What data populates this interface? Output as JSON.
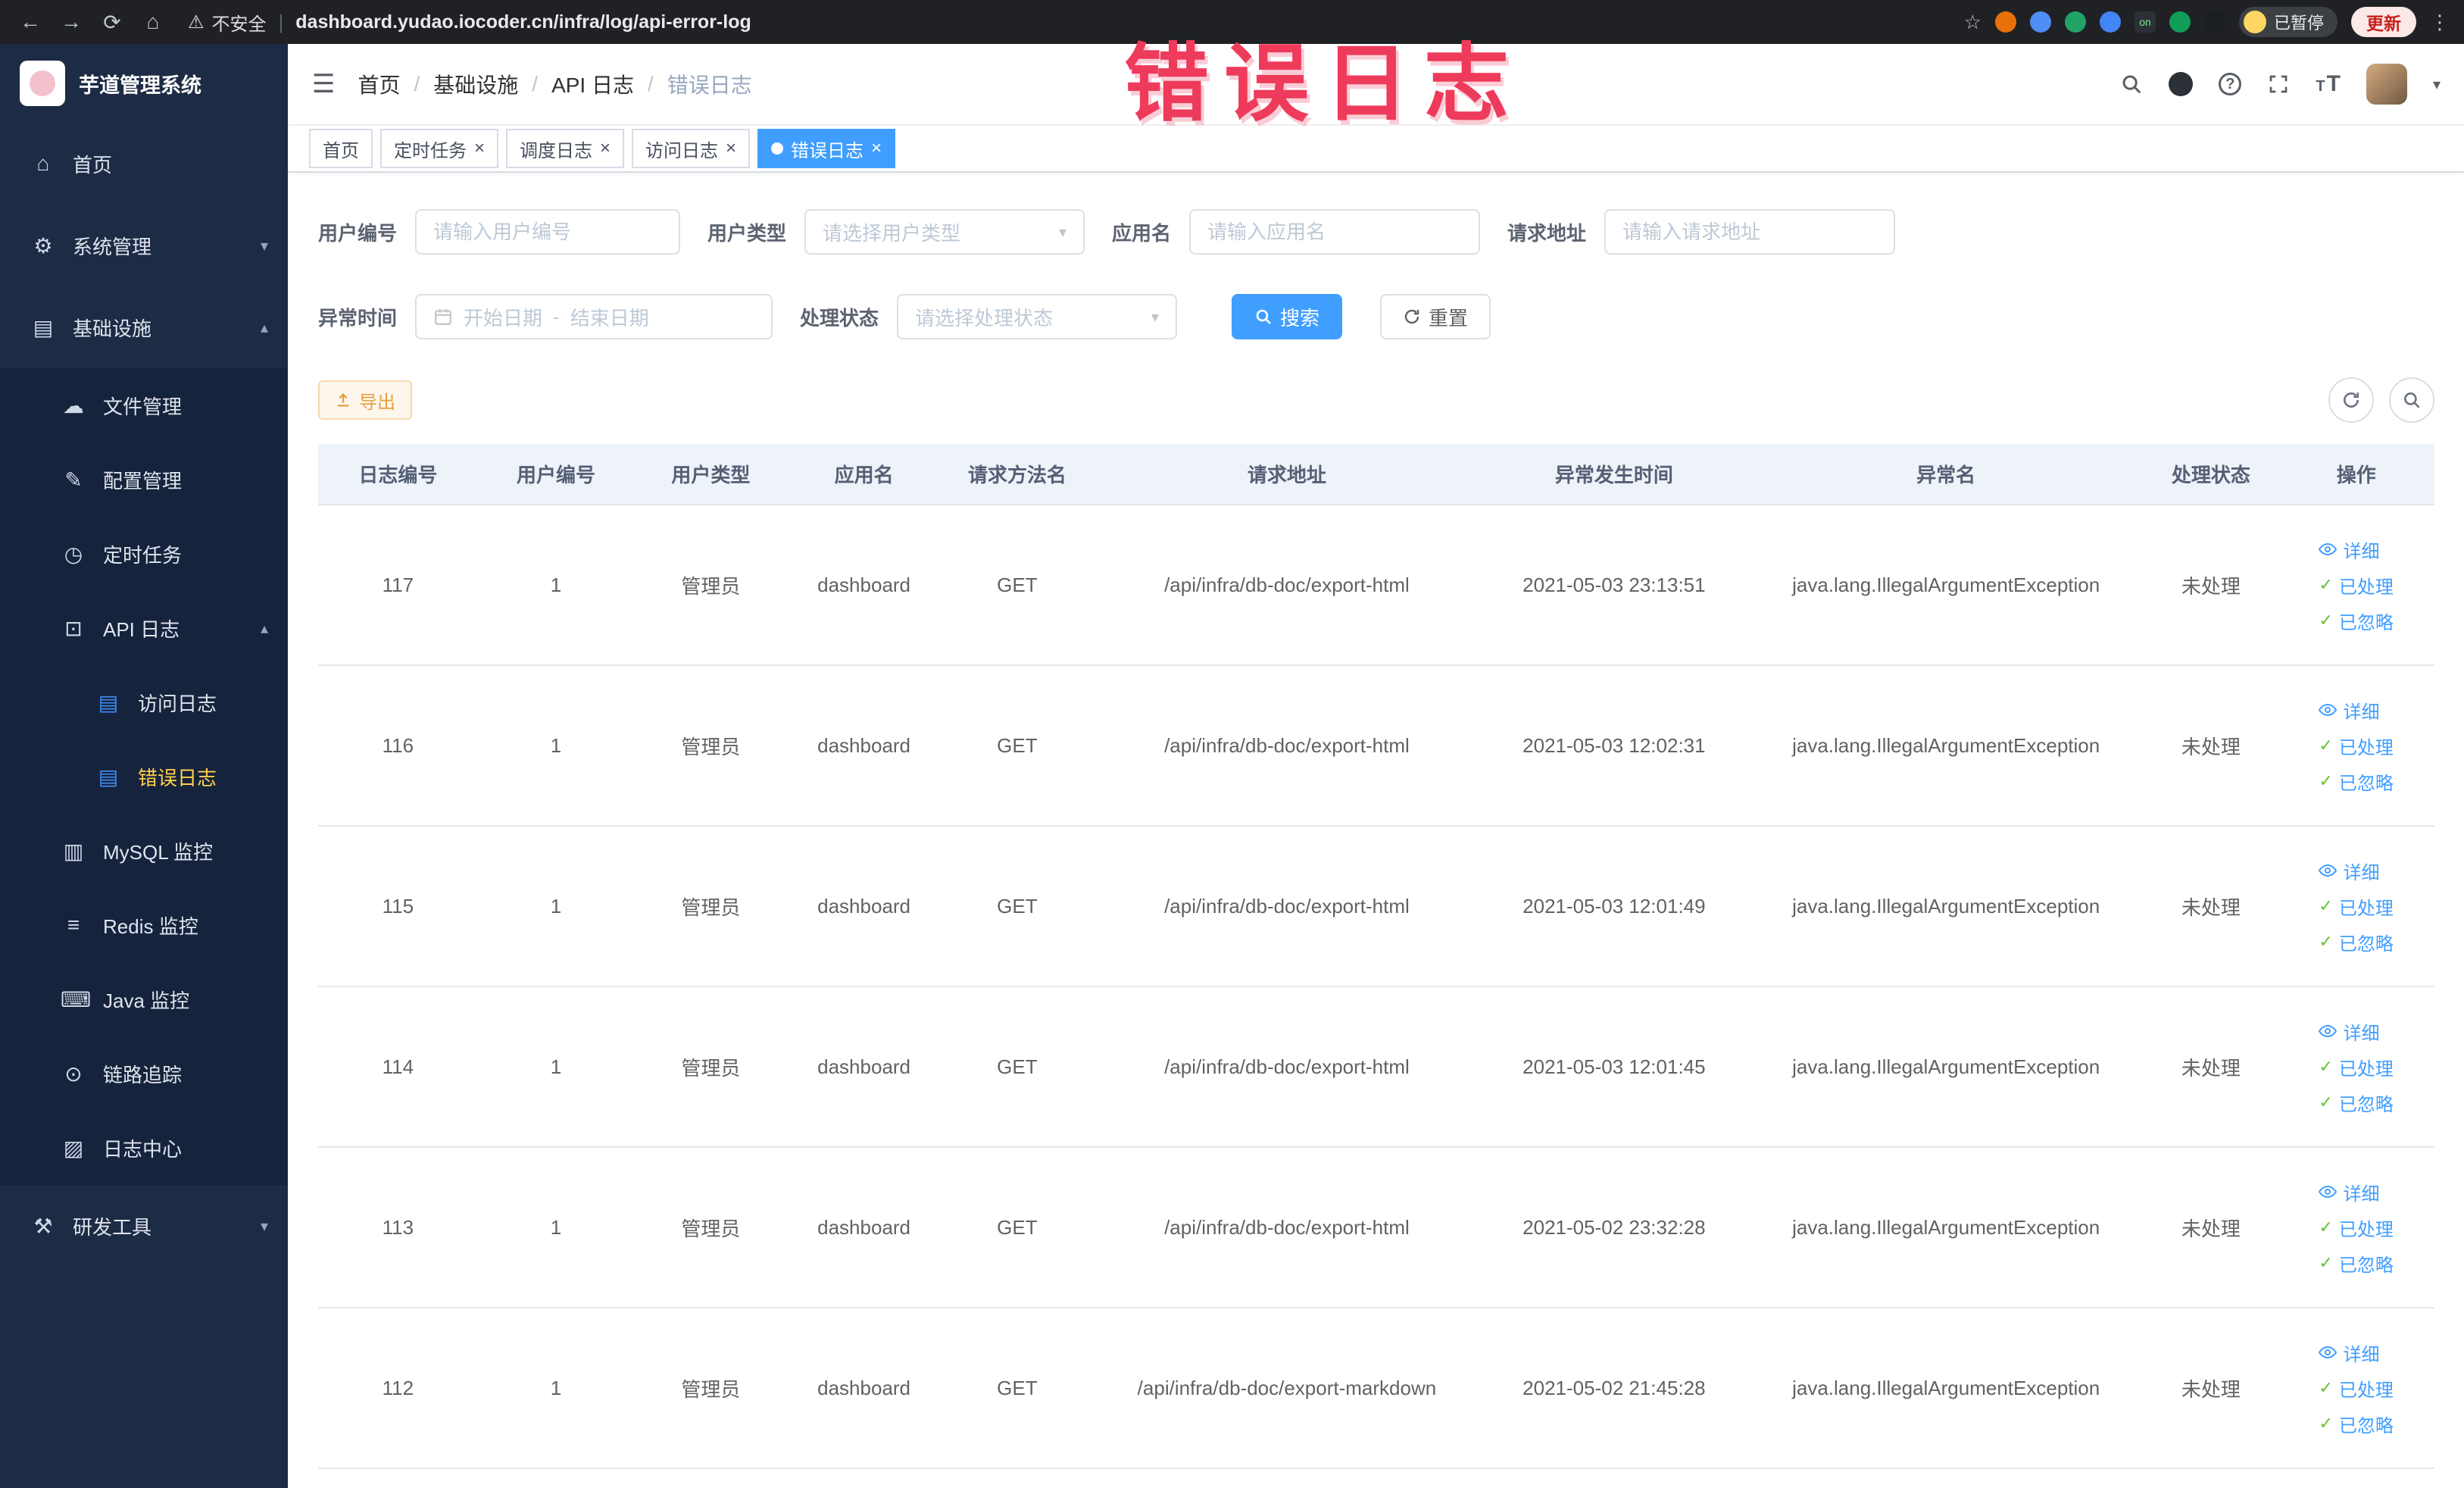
{
  "colors": {
    "accent_blue": "#409eff",
    "menu_active_yellow": "#ffd04b",
    "warning_orange": "#e6a23c",
    "success_green": "#67c23a",
    "watermark_red": "#ee3b5b",
    "sidebar_bg": "#1d2b45"
  },
  "watermark": "错误日志",
  "icons": {
    "back": "←",
    "forward": "→",
    "reload": "⟳",
    "home": "⌂",
    "warning": "⚠",
    "star": "☆",
    "more": "⋮",
    "on_badge": "on",
    "hamburger": "☰",
    "caret_down": "▾",
    "arrow_up": "▴",
    "arrow_down": "▾",
    "close": "×",
    "check": "✓",
    "question": "?",
    "menu_home": "⌂",
    "menu_system": "⚙",
    "menu_infra": "▤",
    "menu_file": "☁",
    "menu_config": "✎",
    "menu_job": "◷",
    "menu_api_log": "⊡",
    "menu_doc": "▤",
    "menu_mysql": "▥",
    "menu_redis": "≡",
    "menu_java": "⌨",
    "menu_trace": "⊙",
    "menu_log_center": "▨",
    "menu_tools": "⚒"
  },
  "browser": {
    "security_label": "不安全",
    "url": "dashboard.yudao.iocoder.cn/infra/log/api-error-log",
    "profile_badge": "已暂停",
    "update_label": "更新"
  },
  "sidebar": {
    "logo_title": "芋道管理系统",
    "items": {
      "home": "首页",
      "system": "系统管理",
      "infra": "基础设施",
      "file": "文件管理",
      "config": "配置管理",
      "job": "定时任务",
      "api_log": "API 日志",
      "access_log": "访问日志",
      "error_log": "错误日志",
      "mysql": "MySQL 监控",
      "redis": "Redis 监控",
      "java": "Java 监控",
      "trace": "链路追踪",
      "log_center": "日志中心",
      "dev_tools": "研发工具"
    }
  },
  "breadcrumb": [
    "首页",
    "基础设施",
    "API 日志",
    "错误日志"
  ],
  "tabs": [
    {
      "label": "首页"
    },
    {
      "label": "定时任务"
    },
    {
      "label": "调度日志"
    },
    {
      "label": "访问日志"
    },
    {
      "label": "错误日志"
    }
  ],
  "filters": {
    "user_id_label": "用户编号",
    "user_id_placeholder": "请输入用户编号",
    "user_type_label": "用户类型",
    "user_type_placeholder": "请选择用户类型",
    "app_name_label": "应用名",
    "app_name_placeholder": "请输入应用名",
    "request_url_label": "请求地址",
    "request_url_placeholder": "请输入请求地址",
    "time_label": "异常时间",
    "time_start_placeholder": "开始日期",
    "time_separator": "-",
    "time_end_placeholder": "结束日期",
    "status_label": "处理状态",
    "status_placeholder": "请选择处理状态",
    "search_label": "搜索",
    "reset_label": "重置"
  },
  "toolbar": {
    "export_label": "导出"
  },
  "table": {
    "columns": [
      "日志编号",
      "用户编号",
      "用户类型",
      "应用名",
      "请求方法名",
      "请求地址",
      "异常发生时间",
      "异常名",
      "处理状态",
      "操作"
    ],
    "action_labels": [
      "详细",
      "已处理",
      "已忽略"
    ],
    "rows": [
      {
        "id": "117",
        "user_id": "1",
        "user_type": "管理员",
        "app": "dashboard",
        "method": "GET",
        "url": "/api/infra/db-doc/export-html",
        "time": "2021-05-03 23:13:51",
        "exception": "java.lang.IllegalArgumentException",
        "status": "未处理"
      },
      {
        "id": "116",
        "user_id": "1",
        "user_type": "管理员",
        "app": "dashboard",
        "method": "GET",
        "url": "/api/infra/db-doc/export-html",
        "time": "2021-05-03 12:02:31",
        "exception": "java.lang.IllegalArgumentException",
        "status": "未处理"
      },
      {
        "id": "115",
        "user_id": "1",
        "user_type": "管理员",
        "app": "dashboard",
        "method": "GET",
        "url": "/api/infra/db-doc/export-html",
        "time": "2021-05-03 12:01:49",
        "exception": "java.lang.IllegalArgumentException",
        "status": "未处理"
      },
      {
        "id": "114",
        "user_id": "1",
        "user_type": "管理员",
        "app": "dashboard",
        "method": "GET",
        "url": "/api/infra/db-doc/export-html",
        "time": "2021-05-03 12:01:45",
        "exception": "java.lang.IllegalArgumentException",
        "status": "未处理"
      },
      {
        "id": "113",
        "user_id": "1",
        "user_type": "管理员",
        "app": "dashboard",
        "method": "GET",
        "url": "/api/infra/db-doc/export-html",
        "time": "2021-05-02 23:32:28",
        "exception": "java.lang.IllegalArgumentException",
        "status": "未处理"
      },
      {
        "id": "112",
        "user_id": "1",
        "user_type": "管理员",
        "app": "dashboard",
        "method": "GET",
        "url": "/api/infra/db-doc/export-markdown",
        "time": "2021-05-02 21:45:28",
        "exception": "java.lang.IllegalArgumentException",
        "status": "未处理"
      }
    ]
  }
}
